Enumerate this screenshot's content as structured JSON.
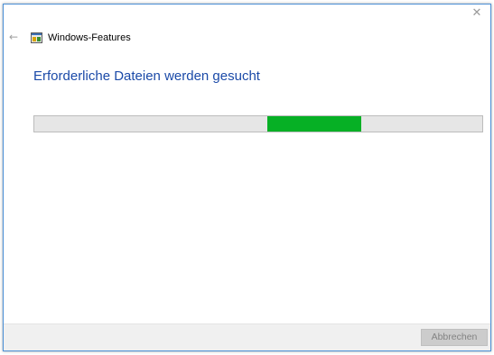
{
  "window": {
    "title": "Windows-Features",
    "close_glyph": "✕",
    "back_glyph": "←"
  },
  "main": {
    "heading": "Erforderliche Dateien werden gesucht"
  },
  "progress": {
    "mode": "indeterminate-marquee",
    "segment_start_fraction": 0.52,
    "segment_end_fraction": 0.73,
    "track_color": "#e6e6e6",
    "fill_color": "#06b025"
  },
  "footer": {
    "cancel_label": "Abbrechen"
  },
  "icons": {
    "app": "windows-features-icon",
    "back": "back-arrow-icon",
    "close": "close-icon"
  },
  "colors": {
    "accent": "#1b4aa8",
    "window_border": "#4a8fd6"
  }
}
